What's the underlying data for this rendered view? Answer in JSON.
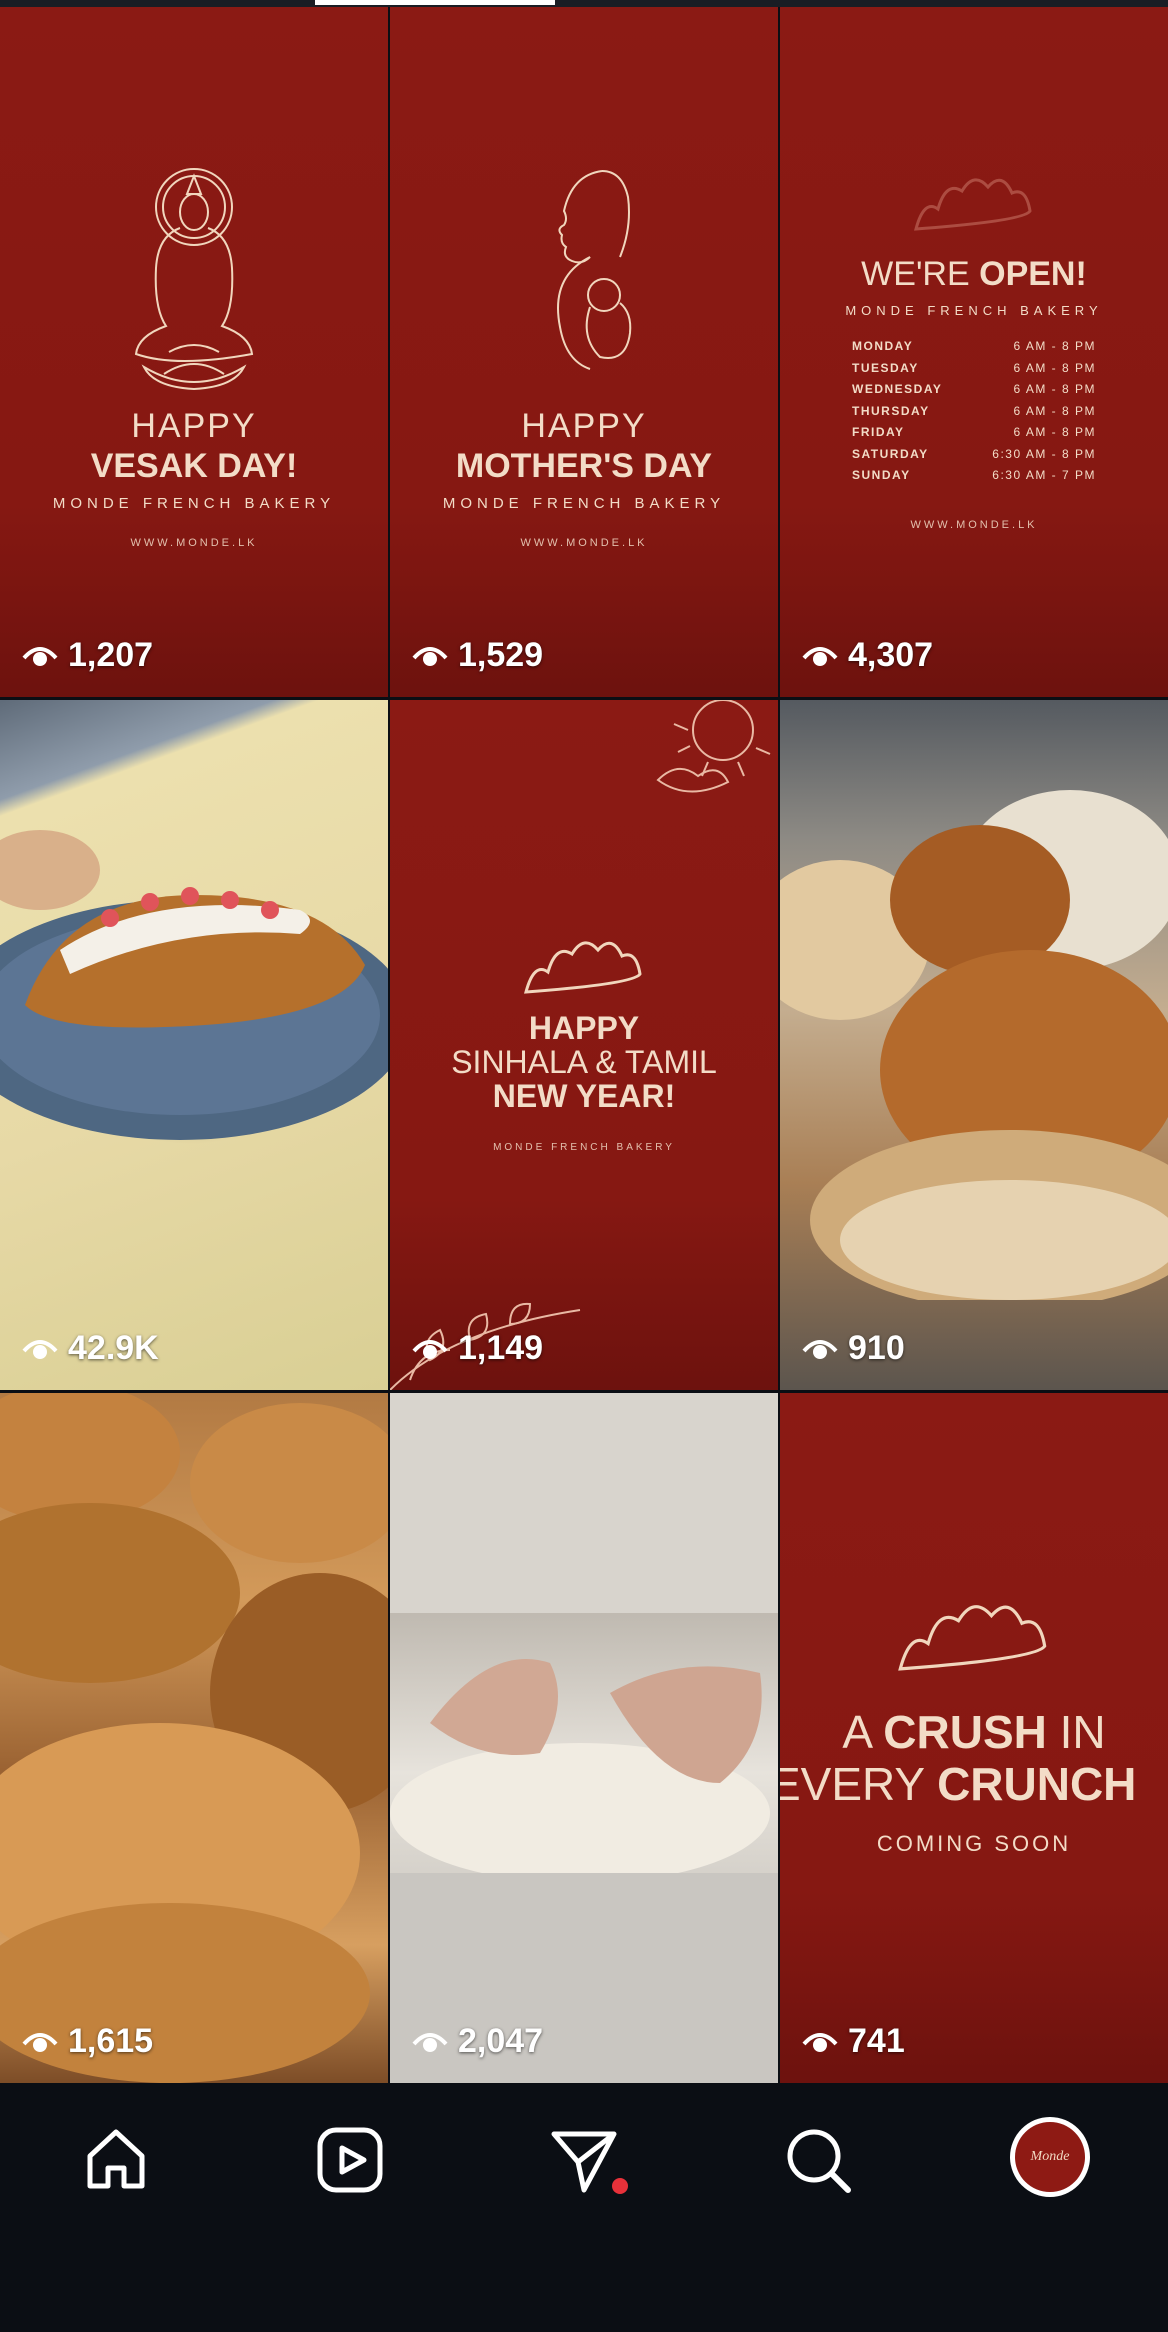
{
  "grid": {
    "tiles": [
      {
        "views": "1,207",
        "poster": {
          "line1": "HAPPY",
          "line2": "VESAK DAY!",
          "brand": "MONDE FRENCH BAKERY",
          "url": "WWW.MONDE.LK"
        }
      },
      {
        "views": "1,529",
        "poster": {
          "line1": "HAPPY",
          "line2": "MOTHER'S DAY",
          "brand": "MONDE FRENCH BAKERY",
          "url": "WWW.MONDE.LK"
        }
      },
      {
        "views": "4,307",
        "poster": {
          "title_light": "WE'RE",
          "title_bold": "OPEN!",
          "brand": "MONDE FRENCH BAKERY",
          "url": "WWW.MONDE.LK",
          "hours": [
            {
              "day": "MONDAY",
              "time": "6 AM - 8 PM"
            },
            {
              "day": "TUESDAY",
              "time": "6 AM - 8 PM"
            },
            {
              "day": "WEDNESDAY",
              "time": "6 AM - 8 PM"
            },
            {
              "day": "THURSDAY",
              "time": "6 AM - 8 PM"
            },
            {
              "day": "FRIDAY",
              "time": "6 AM - 8 PM"
            },
            {
              "day": "SATURDAY",
              "time": "6:30 AM - 8 PM"
            },
            {
              "day": "SUNDAY",
              "time": "6:30 AM - 7 PM"
            }
          ]
        }
      },
      {
        "views": "42.9K"
      },
      {
        "views": "1,149",
        "poster": {
          "line1": "HAPPY",
          "line2": "SINHALA & TAMIL",
          "line3": "NEW YEAR!",
          "brand": "MONDE FRENCH BAKERY"
        }
      },
      {
        "views": "910"
      },
      {
        "views": "1,615"
      },
      {
        "views": "2,047"
      },
      {
        "views": "741",
        "poster": {
          "line1_light": "A",
          "line1_bold": "CRUSH",
          "line1_light2": "IN",
          "line2_light": "EVERY",
          "line2_bold": "CRUNCH",
          "sub": "COMING SOON"
        }
      }
    ]
  },
  "nav": {
    "icons": [
      "home-icon",
      "reels-icon",
      "send-icon",
      "search-icon",
      "profile-avatar"
    ],
    "avatar_text": "Monde"
  },
  "colors": {
    "poster_red": "#8b1a14",
    "cream": "#f3dcc7",
    "nav_bg": "#0b0e14",
    "notification_dot": "#e8313a"
  }
}
